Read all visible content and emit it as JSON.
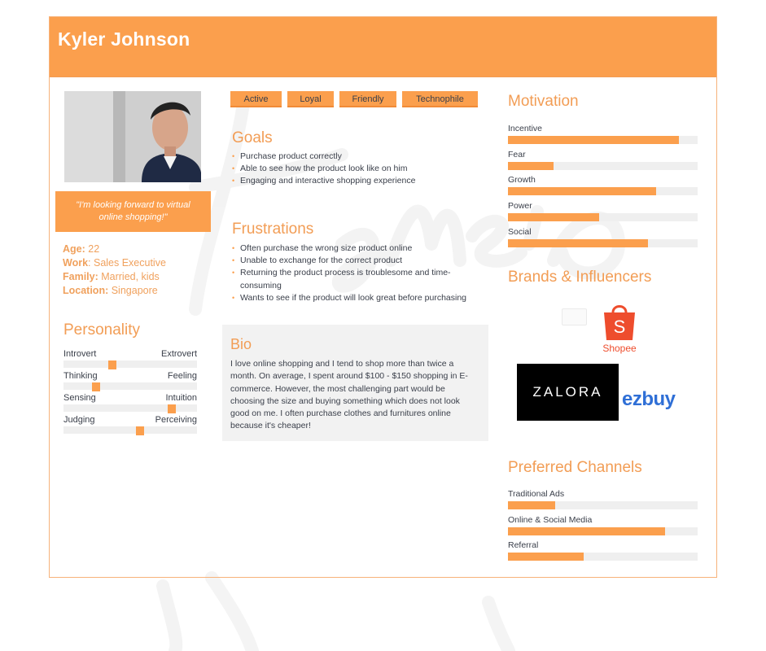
{
  "persona": {
    "name": "Kyler Johnson",
    "quote": "\"I'm looking forward to virtual online shopping!\"",
    "details": [
      {
        "label": "Age:",
        "value": " 22"
      },
      {
        "label": "Work",
        "value": ": Sales Executive"
      },
      {
        "label": "Family:",
        "value": " Married, kids"
      },
      {
        "label": "Location:",
        "value": " Singapore"
      }
    ],
    "photo_alt": "portrait-photo"
  },
  "personality": {
    "title": "Personality",
    "traits": [
      {
        "left": "Introvert",
        "right": "Extrovert",
        "level": 0.36
      },
      {
        "left": "Thinking",
        "right": "Feeling",
        "level": 0.23
      },
      {
        "left": "Sensing",
        "right": "Intuition",
        "level": 0.83
      },
      {
        "left": "Judging",
        "right": "Perceiving",
        "level": 0.58
      }
    ]
  },
  "tags": [
    "Active",
    "Loyal",
    "Friendly",
    "Technophile"
  ],
  "goals": {
    "title": "Goals",
    "items": [
      "Purchase product correctly",
      "Able to see how the product look like on him",
      "Engaging and interactive shopping experience"
    ]
  },
  "frustrations": {
    "title": "Frustrations",
    "items": [
      "Often purchase the wrong size product online",
      "Unable to exchange for the correct product",
      "Returning the product process is troublesome and time-consuming",
      "Wants to see if the product will look great before purchasing"
    ]
  },
  "bio": {
    "title": "Bio",
    "text": "I love online shopping and I tend to shop more than twice a month. On average, I spent around $100 - $150 shopping in E-commerce. However, the most challenging part would be choosing the size and buying something which does not look good on me. I often purchase clothes and furnitures online because it's cheaper!"
  },
  "motivation": {
    "title": "Motivation",
    "items": [
      {
        "label": "Incentive",
        "value": 0.9
      },
      {
        "label": "Fear",
        "value": 0.24
      },
      {
        "label": "Growth",
        "value": 0.78
      },
      {
        "label": "Power",
        "value": 0.48
      },
      {
        "label": "Social",
        "value": 0.74
      }
    ]
  },
  "brands": {
    "title": "Brands & Influencers",
    "shopee_label": "Shopee",
    "zalora_label": "ZALORA",
    "ezbuy_label": "ezbuy"
  },
  "channels": {
    "title": "Preferred Channels",
    "items": [
      {
        "label": "Traditional Ads",
        "value": 0.25
      },
      {
        "label": "Online & Social Media",
        "value": 0.83
      },
      {
        "label": "Referral",
        "value": 0.4
      }
    ]
  },
  "colors": {
    "accent": "#fb9f4d",
    "accent_text": "#f29d55",
    "track": "#efefef",
    "body_text": "#3a3f4a"
  }
}
